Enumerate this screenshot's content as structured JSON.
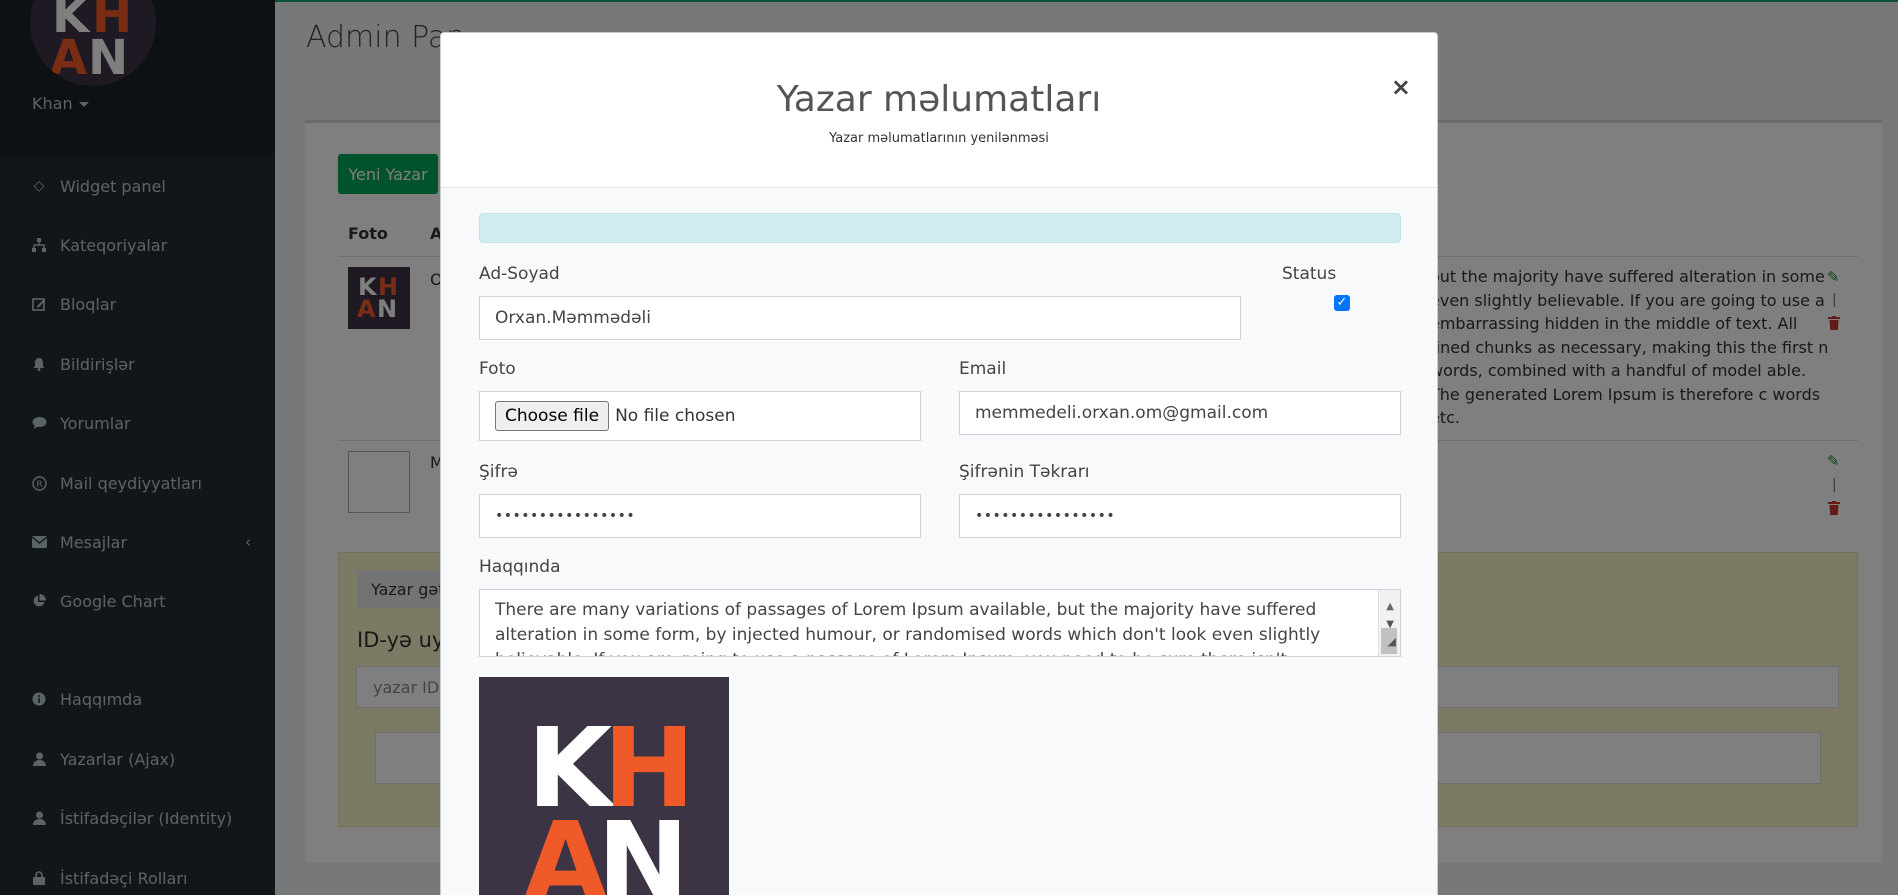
{
  "sidebar": {
    "logo": {
      "line1": [
        "K",
        "H"
      ],
      "line2": [
        "A",
        "N"
      ]
    },
    "user_name": "Khan",
    "items": [
      {
        "label": "Widget panel",
        "icon": "diamond-icon"
      },
      {
        "label": "Kateqoriyalar",
        "icon": "sitemap-icon"
      },
      {
        "label": "Bloqlar",
        "icon": "edit-square-icon"
      },
      {
        "label": "Bildirişlər",
        "icon": "bell-icon"
      },
      {
        "label": "Yorumlar",
        "icon": "comment-icon"
      },
      {
        "label": "Mail qeydiyyatları",
        "icon": "registered-icon"
      },
      {
        "label": "Mesajlar",
        "icon": "envelope-icon"
      },
      {
        "label": "Google Chart",
        "icon": "pie-chart-icon"
      },
      {
        "label": "Haqqımda",
        "icon": "info-icon"
      },
      {
        "label": "Yazarlar (Ajax)",
        "icon": "user-icon"
      },
      {
        "label": "İstifadəçilər (Identity)",
        "icon": "user-icon"
      },
      {
        "label": "İstifadəçi Rolları",
        "icon": "lock-icon"
      }
    ],
    "mesajlar_chevron": "‹"
  },
  "main": {
    "page_title": "Admin Pan",
    "new_button": "Yeni Yazar",
    "columns": [
      "Foto",
      "A"
    ],
    "row1": {
      "name_fragment": "O",
      "about_fragment": "out the majority have suffered alteration in some even slightly believable. If you are going to use a embarrassing hidden in the middle of text. All fined chunks as necessary, making this the first n words, combined with a handful of model able. The generated Lorem Ipsum is therefore c words etc."
    },
    "row2": {
      "name_fragment": "M"
    },
    "action_separator": "|",
    "search": {
      "tab_label": "Yazar gət",
      "title": "ID-yə uyğ",
      "input_placeholder": "yazar ID"
    }
  },
  "modal": {
    "title": "Yazar məlumatları",
    "subtitle": "Yazar məlumatlarının yenilənməsi",
    "close": "×",
    "fields": {
      "name_label": "Ad-Soyad",
      "name_value": "Orxan.Məmmədəli",
      "status_label": "Status",
      "status_checked": true,
      "photo_label": "Foto",
      "file_button": "Choose file",
      "file_status": "No file chosen",
      "email_label": "Email",
      "email_value": "memmedeli.orxan.om@gmail.com",
      "password_label": "Şifrə",
      "password_value": "••••••••••••••••",
      "password_repeat_label": "Şifrənin Təkrarı",
      "password_repeat_value": "••••••••••••••••",
      "about_label": "Haqqında",
      "about_value": "There are many variations of passages of Lorem Ipsum available, but the majority have suffered alteration in some form, by injected humour, or randomised words which don't look even slightly believable. If you are going to use a passage of Lorem Ipsum, you need to be sure there isn't anything embarrassing hidden in the middle of text."
    },
    "preview_logo": {
      "line1": [
        "K",
        "H"
      ],
      "line2": [
        "A",
        "N"
      ]
    }
  },
  "colors": {
    "sidebar_bg": "#222d32",
    "accent_green": "#00a65a",
    "logo_bg": "#3c3344",
    "logo_orange": "#f05a28",
    "logo_white": "#ffffff"
  }
}
